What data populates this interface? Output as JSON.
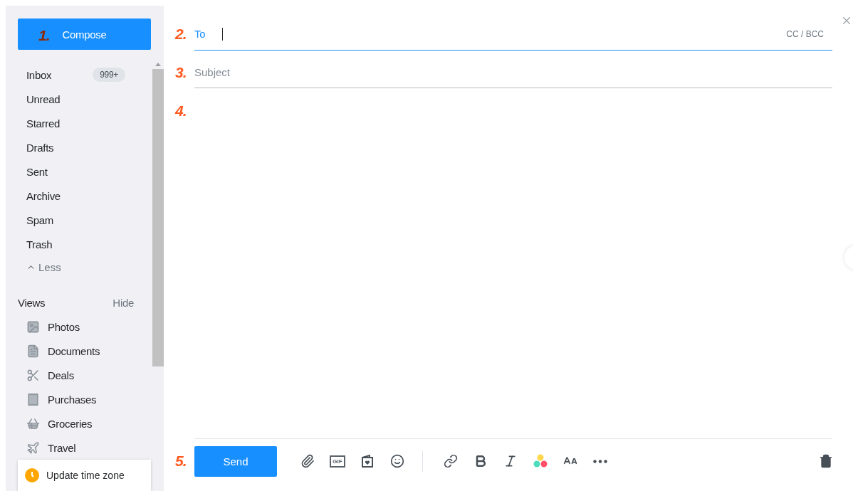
{
  "sidebar": {
    "compose": {
      "label": "Compose",
      "marker": "1."
    },
    "folders": [
      {
        "label": "Inbox",
        "badge": "999+"
      },
      {
        "label": "Unread"
      },
      {
        "label": "Starred"
      },
      {
        "label": "Drafts"
      },
      {
        "label": "Sent"
      },
      {
        "label": "Archive"
      },
      {
        "label": "Spam"
      },
      {
        "label": "Trash"
      }
    ],
    "less": "Less",
    "views": {
      "title": "Views",
      "toggle": "Hide",
      "items": [
        {
          "label": "Photos",
          "kind": "photos"
        },
        {
          "label": "Documents",
          "kind": "document"
        },
        {
          "label": "Deals",
          "kind": "scissors"
        },
        {
          "label": "Purchases",
          "kind": "receipt"
        },
        {
          "label": "Groceries",
          "kind": "basket"
        },
        {
          "label": "Travel",
          "kind": "plane"
        }
      ]
    }
  },
  "toast": {
    "text": "Update time zone"
  },
  "compose_form": {
    "to": {
      "label": "To",
      "marker": "2.",
      "focused": true
    },
    "cc_bcc": "CC / BCC",
    "subject": {
      "placeholder": "Subject",
      "marker": "3.",
      "focused": false
    },
    "body": {
      "marker": "4."
    },
    "send": {
      "label": "Send",
      "marker": "5."
    },
    "toolbar": [
      {
        "kind": "attach"
      },
      {
        "kind": "gif",
        "label": "GIF"
      },
      {
        "kind": "card"
      },
      {
        "kind": "emoji"
      },
      {
        "kind": "divider"
      },
      {
        "kind": "link"
      },
      {
        "kind": "bold"
      },
      {
        "kind": "italic"
      },
      {
        "kind": "colors"
      },
      {
        "kind": "font-size"
      },
      {
        "kind": "more"
      }
    ]
  }
}
